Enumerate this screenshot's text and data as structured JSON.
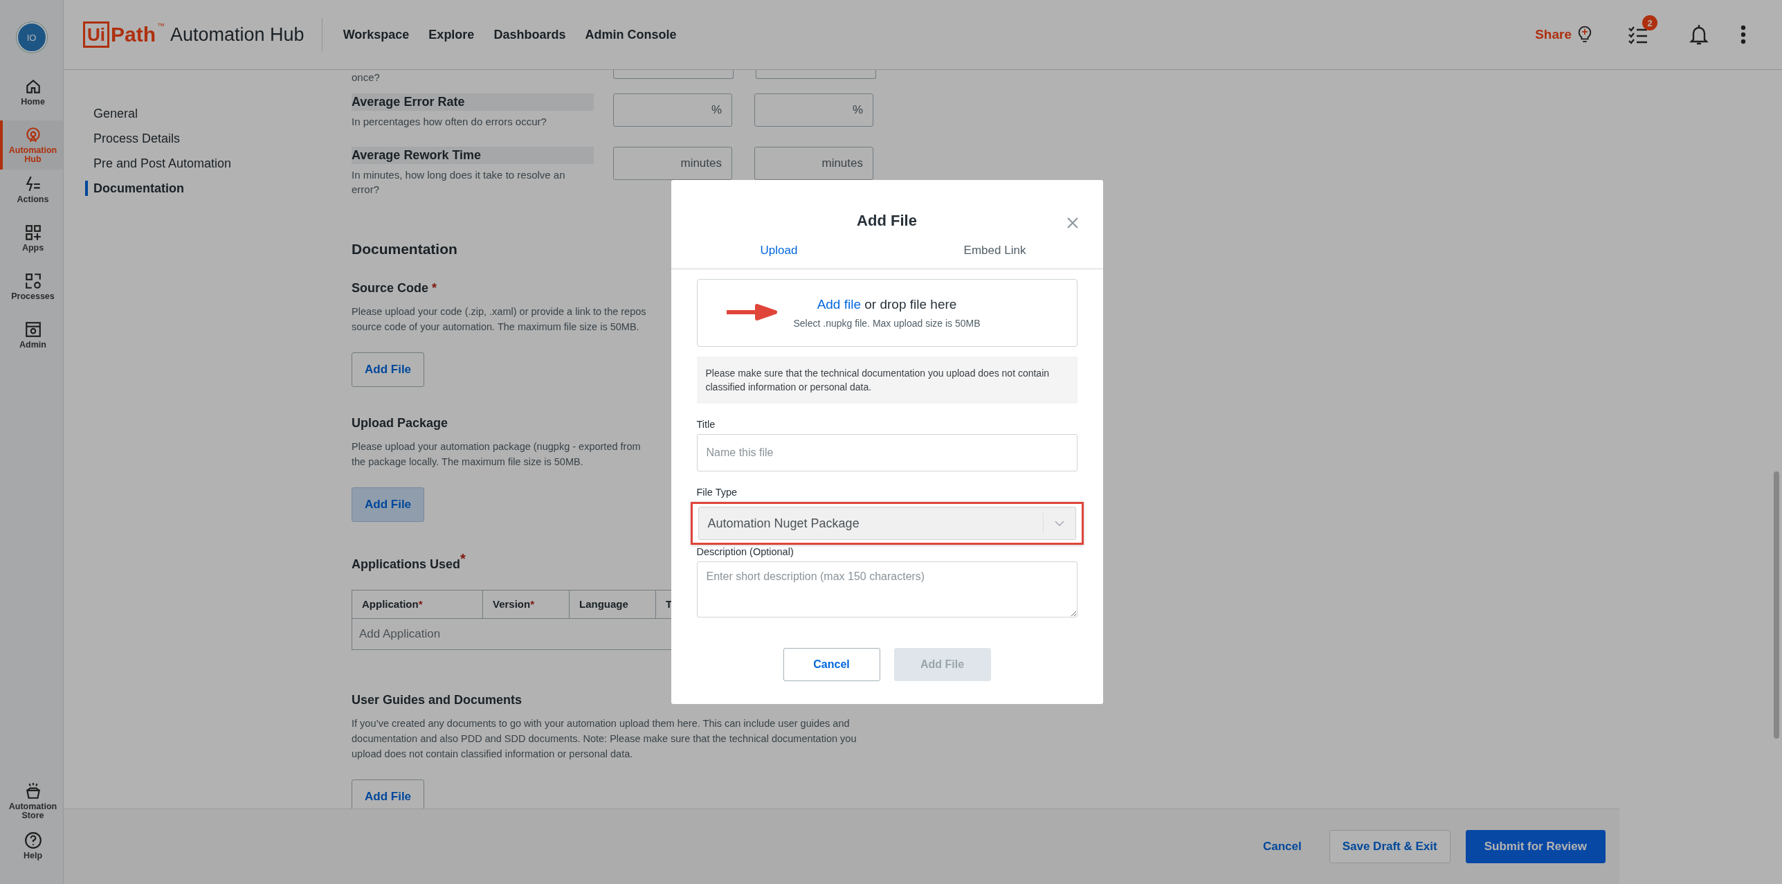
{
  "app": {
    "logo_mark": "Ui",
    "logo_word": "Path",
    "trademark": "™",
    "product": "Automation Hub"
  },
  "top_nav": [
    "Workspace",
    "Explore",
    "Dashboards",
    "Admin Console"
  ],
  "header_actions": {
    "share_label": "Share",
    "tasks_badge": "2"
  },
  "sidebar": {
    "avatar": "IO",
    "items": [
      {
        "label": "Home",
        "kind": "home",
        "selected": false
      },
      {
        "label": "Automation Hub",
        "kind": "hub",
        "selected": true
      },
      {
        "label": "Actions",
        "kind": "actions",
        "selected": false
      },
      {
        "label": "Apps",
        "kind": "apps",
        "selected": false
      },
      {
        "label": "Processes",
        "kind": "processes",
        "selected": false
      },
      {
        "label": "Admin",
        "kind": "admin",
        "selected": false
      }
    ],
    "bottom_items": [
      {
        "label": "Automation Store",
        "kind": "store"
      },
      {
        "label": "Help",
        "kind": "help"
      }
    ]
  },
  "section_nav": [
    {
      "label": "General",
      "selected": false
    },
    {
      "label": "Process Details",
      "selected": false
    },
    {
      "label": "Pre and Post Automation",
      "selected": false
    },
    {
      "label": "Documentation",
      "selected": true
    }
  ],
  "form": {
    "partial_question": "once?",
    "metrics": [
      {
        "label": "Average Error Rate",
        "hint": "In percentages how often do errors occur?",
        "units": [
          "%",
          "%"
        ]
      },
      {
        "label": "Average Rework Time",
        "hint": "In minutes, how long does it take to resolve an error?",
        "units": [
          "minutes",
          "minutes"
        ]
      }
    ]
  },
  "documentation": {
    "heading": "Documentation",
    "uploads": [
      {
        "title": "Source Code",
        "required_mark": "*",
        "text_lines": [
          "Please upload your code (.zip, .xaml) or provide a link to the repos",
          "source code of your automation. The maximum file size is 50MB."
        ],
        "button": "Add File",
        "highlighted": false
      },
      {
        "title": "Upload Package",
        "text_lines": [
          "Please upload your automation package (nugpkg - exported from",
          "the package locally. The maximum file size is 50MB."
        ],
        "button": "Add File",
        "highlighted": true
      }
    ],
    "applications": {
      "title": "Applications Used",
      "required_mark": "*",
      "columns": [
        {
          "label": "Application",
          "required_mark": "*"
        },
        {
          "label": "Version",
          "required_mark": "*"
        },
        {
          "label": "Language"
        },
        {
          "label": "T"
        }
      ],
      "placeholder": "Add Application"
    },
    "user_guides": {
      "title": "User Guides and Documents",
      "text": "If you’ve created any documents to go with your automation upload them here. This can include user guides and documentation and also PDD and SDD documents. Note: Please make sure that the technical documentation you upload does not contain classified information or personal data.",
      "button": "Add File"
    }
  },
  "footer": {
    "buttons": [
      {
        "label": "Cancel",
        "kind": "link"
      },
      {
        "label": "Save Draft & Exit",
        "kind": "secondary"
      },
      {
        "label": "Submit for Review",
        "kind": "primary"
      }
    ]
  },
  "dialog": {
    "title": "Add File",
    "tabs": [
      {
        "label": "Upload",
        "selected": true
      },
      {
        "label": "Embed Link",
        "selected": false
      }
    ],
    "dropzone": {
      "link": "Add file",
      "text": "or drop file here",
      "hint": "Select .nupkg file. Max upload size is 50MB"
    },
    "notice": "Please make sure that the technical documentation you upload does not contain classified information or personal data.",
    "fields": [
      {
        "kind": "text",
        "label": "Title",
        "placeholder": "Name this file"
      },
      {
        "kind": "select",
        "label": "File Type",
        "value": "Automation Nuget Package",
        "disabled": true,
        "highlighted": true
      },
      {
        "kind": "textarea",
        "label": "Description (Optional)",
        "placeholder": "Enter short description (max 150 characters)"
      }
    ],
    "buttons": [
      {
        "label": "Cancel",
        "kind": "secondary",
        "disabled": false
      },
      {
        "label": "Add File",
        "kind": "primary",
        "disabled": true
      }
    ]
  }
}
